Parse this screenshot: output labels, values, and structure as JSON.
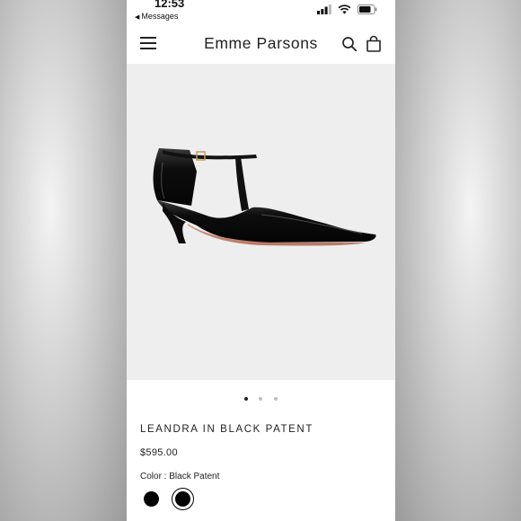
{
  "status_bar": {
    "time": "12:53",
    "back_label": "Messages"
  },
  "header": {
    "brand": "Emme Parsons",
    "icons": [
      "menu-icon",
      "search-icon",
      "bag-icon"
    ]
  },
  "gallery": {
    "slide_count": 3,
    "active_slide": 1
  },
  "product": {
    "title": "LEANDRA IN BLACK PATENT",
    "price": "$595.00",
    "color_label": "Color : ",
    "color_value": "Black Patent",
    "swatches": [
      {
        "color": "#000000",
        "selected": false
      },
      {
        "color": "#000000",
        "selected": true
      }
    ]
  },
  "colors": {
    "page_bg": "#ffffff",
    "image_bg": "#eeeeee",
    "text": "#222222",
    "dot_inactive": "#bdbdbd"
  }
}
